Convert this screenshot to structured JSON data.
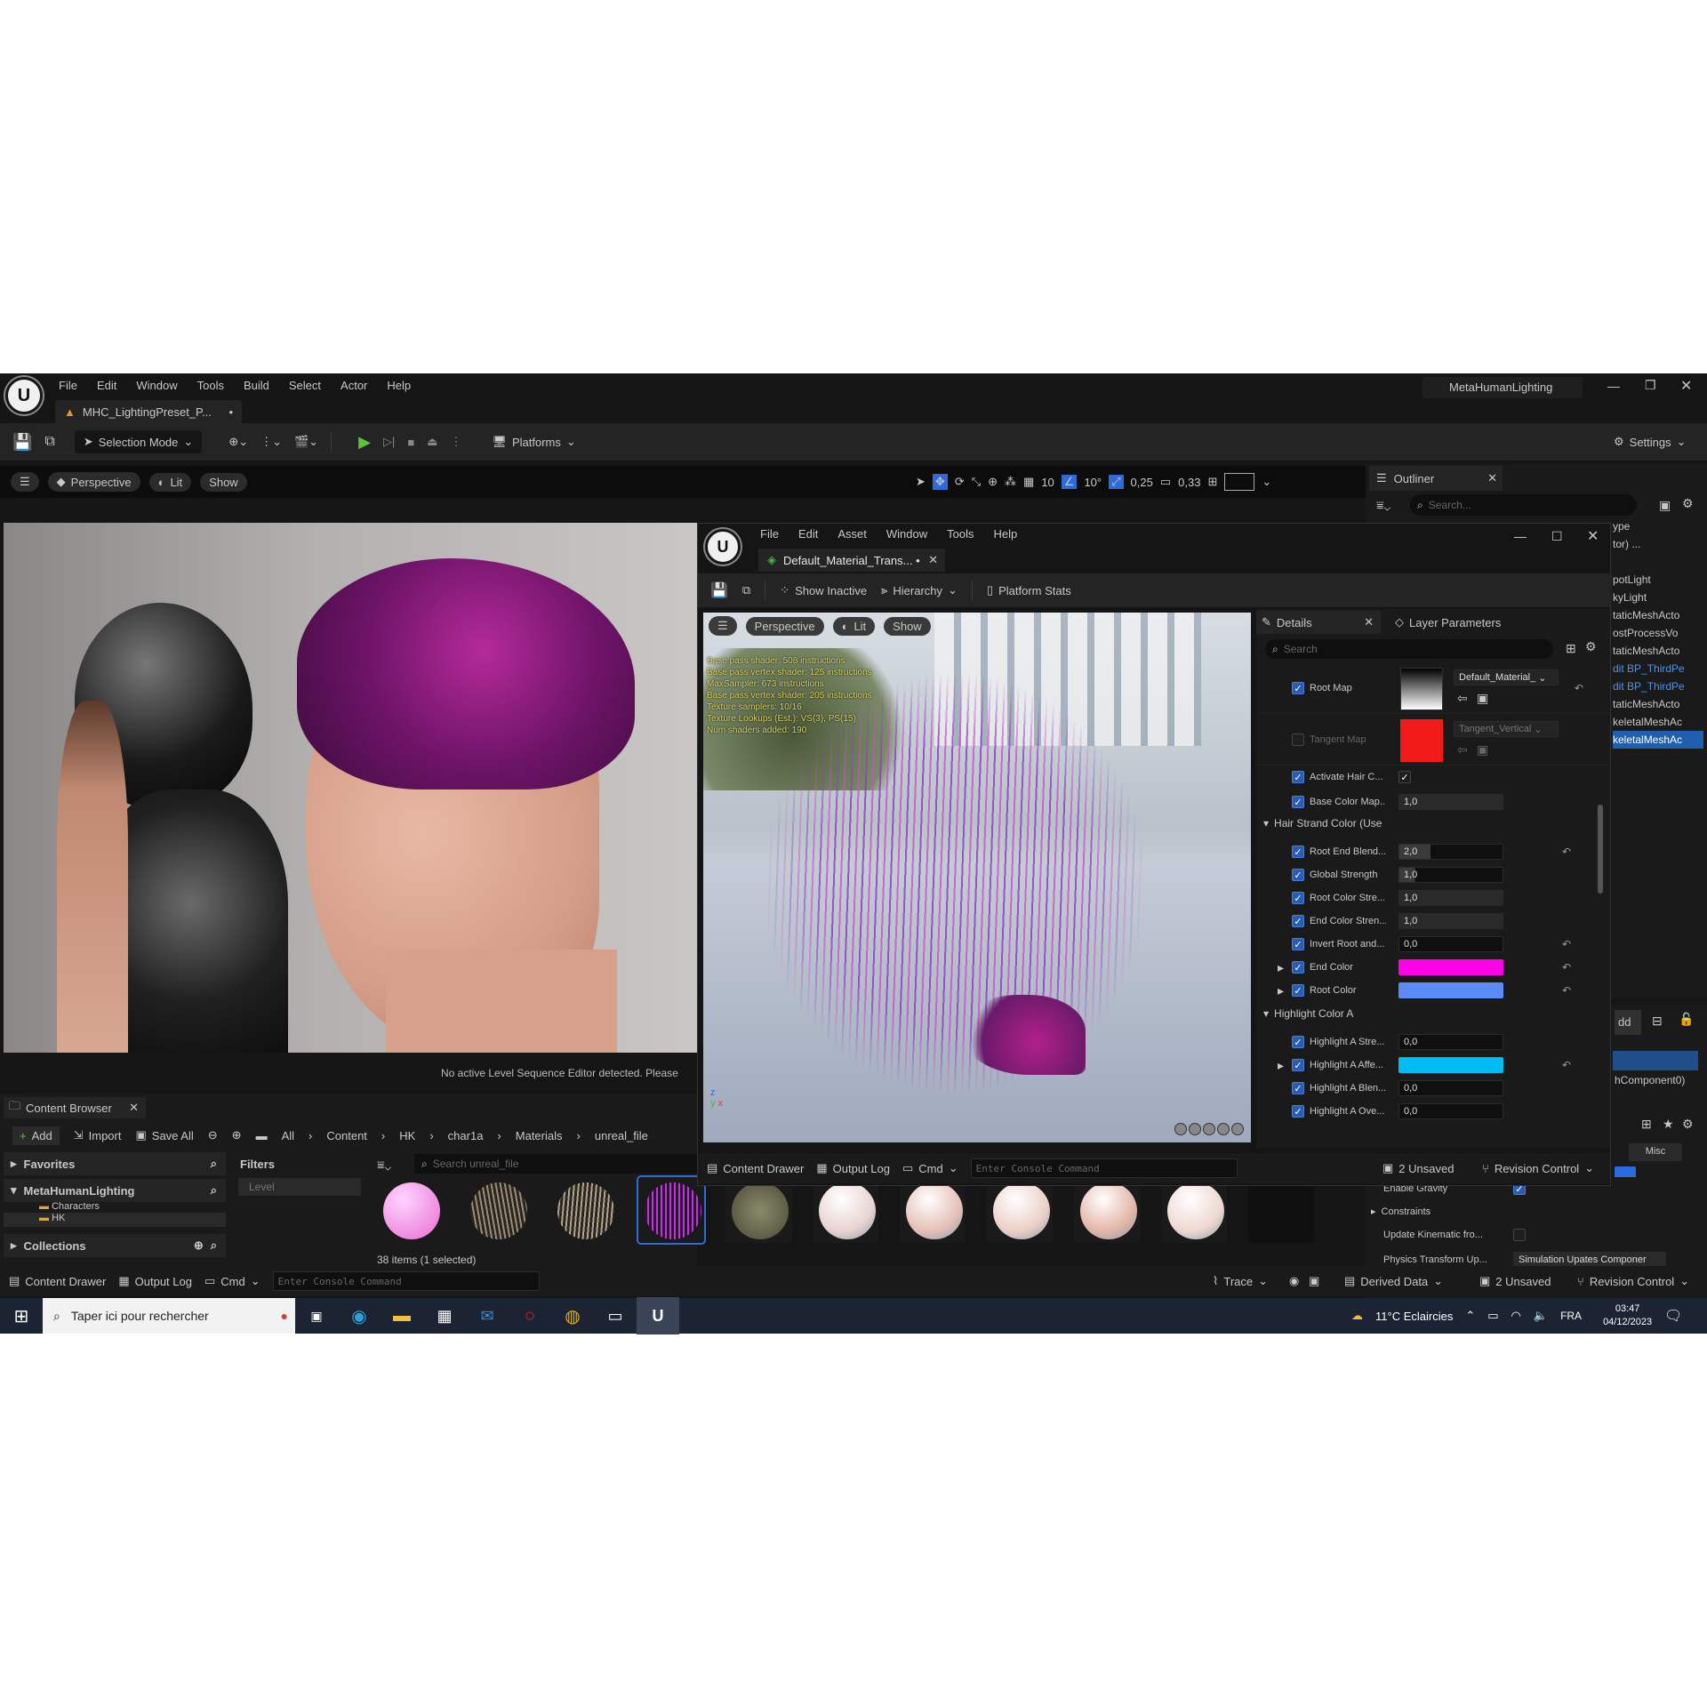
{
  "editor": {
    "menu": [
      "File",
      "Edit",
      "Window",
      "Tools",
      "Build",
      "Select",
      "Actor",
      "Help"
    ],
    "project_name": "MetaHumanLighting",
    "level_tab": "MHC_LightingPreset_P...",
    "selection_mode": "Selection Mode",
    "platforms": "Platforms",
    "settings": "Settings",
    "viewport": {
      "perspective": "Perspective",
      "lit": "Lit",
      "show": "Show",
      "grid": "10",
      "angle": "10°",
      "scale": "0,25",
      "camera": "0,33",
      "sequencer_msg": "No active Level Sequence Editor detected. Please"
    }
  },
  "outliner": {
    "tab": "Outliner",
    "search_placeholder": "Search...",
    "items": [
      "ype",
      "tor) ...",
      "",
      "potLight",
      "kyLight",
      "taticMeshActo",
      "ostProcessVo",
      "taticMeshActo",
      "dit BP_ThirdPe",
      "dit BP_ThirdPe",
      "taticMeshActo",
      "keletalMeshAc",
      "keletalMeshAc"
    ],
    "add_label": "dd",
    "component_label": "hComponent0)",
    "misc_label": "Misc",
    "tance_label": "tanceDynan",
    "enable_gravity": "Enable Gravity",
    "constraints": "Constraints",
    "update_kinematic": "Update Kinematic fro...",
    "physics_transform": "Physics Transform Up...",
    "physics_value": "Simulation Upates Componer"
  },
  "material_editor": {
    "menu": [
      "File",
      "Edit",
      "Asset",
      "Window",
      "Tools",
      "Help"
    ],
    "tab": "Default_Material_Trans... •",
    "show_inactive": "Show Inactive",
    "hierarchy": "Hierarchy",
    "platform_stats": "Platform Stats",
    "viewport": {
      "perspective": "Perspective",
      "lit": "Lit",
      "show": "Show"
    },
    "stats": [
      "Base pass shader: 508 instructions",
      "Base pass vertex shader: 125 instructions",
      "MaxSampler: 673 instructions",
      "Base pass vertex shader: 205 instructions",
      "Texture samplers: 10/16",
      "Texture Lookups (Est.): VS(3), PS(15)",
      "Num shaders added: 190"
    ],
    "details_tab": "Details",
    "layer_tab": "Layer Parameters",
    "search_placeholder": "Search",
    "root_map": {
      "label": "Root Map",
      "value": "Default_Material_"
    },
    "tangent_map": {
      "label": "Tangent Map",
      "value": "Tangent_Vertical"
    },
    "activate_hair": "Activate Hair C...",
    "base_color_map": {
      "label": "Base Color Map...",
      "value": "1,0"
    },
    "group_hair": "Hair Strand Color (Use",
    "props_hair": [
      {
        "label": "Root End Blend...",
        "value": "2,0"
      },
      {
        "label": "Global Strength",
        "value": "1,0"
      },
      {
        "label": "Root Color Stre...",
        "value": "1,0"
      },
      {
        "label": "End Color Stren...",
        "value": "1,0"
      },
      {
        "label": "Invert Root and...",
        "value": "0,0"
      }
    ],
    "end_color": {
      "label": "End Color",
      "hex": "#ff00e6"
    },
    "root_color": {
      "label": "Root Color",
      "hex": "#5b8bf7"
    },
    "group_highlight": "Highlight Color A",
    "highlight_strength": {
      "label": "Highlight A Stre...",
      "value": "0,0"
    },
    "highlight_affects": {
      "label": "Highlight A Affe...",
      "hex": "#00bcf2"
    },
    "highlight_blend": {
      "label": "Highlight A Blen...",
      "value": "0,0"
    },
    "highlight_over": {
      "label": "Highlight A Ove...",
      "value": "0,0"
    },
    "bottom": {
      "drawer": "Content Drawer",
      "output": "Output Log",
      "cmd": "Cmd",
      "console": "Enter Console Command",
      "unsaved": "2 Unsaved",
      "revision": "Revision Control"
    }
  },
  "content_browser": {
    "tab": "Content Browser",
    "add": "Add",
    "import": "Import",
    "save_all": "Save All",
    "breadcrumb": [
      "All",
      "Content",
      "HK",
      "char1a",
      "Materials",
      "unreal_file"
    ],
    "favorites": "Favorites",
    "project": "MetaHumanLighting",
    "tree": [
      "Characters",
      "HK"
    ],
    "collections": "Collections",
    "filters": "Filters",
    "filter_item": "Level",
    "search_placeholder": "Search unreal_file",
    "count": "38 items (1 selected)"
  },
  "status_bar": {
    "drawer": "Content Drawer",
    "output": "Output Log",
    "cmd": "Cmd",
    "console": "Enter Console Command",
    "trace": "Trace",
    "derived": "Derived Data",
    "unsaved": "2 Unsaved",
    "revision": "Revision Control"
  },
  "taskbar": {
    "search": "Taper ici pour rechercher",
    "weather": "11°C  Eclaircies",
    "lang": "FRA",
    "time": "03:47",
    "date": "04/12/2023"
  }
}
